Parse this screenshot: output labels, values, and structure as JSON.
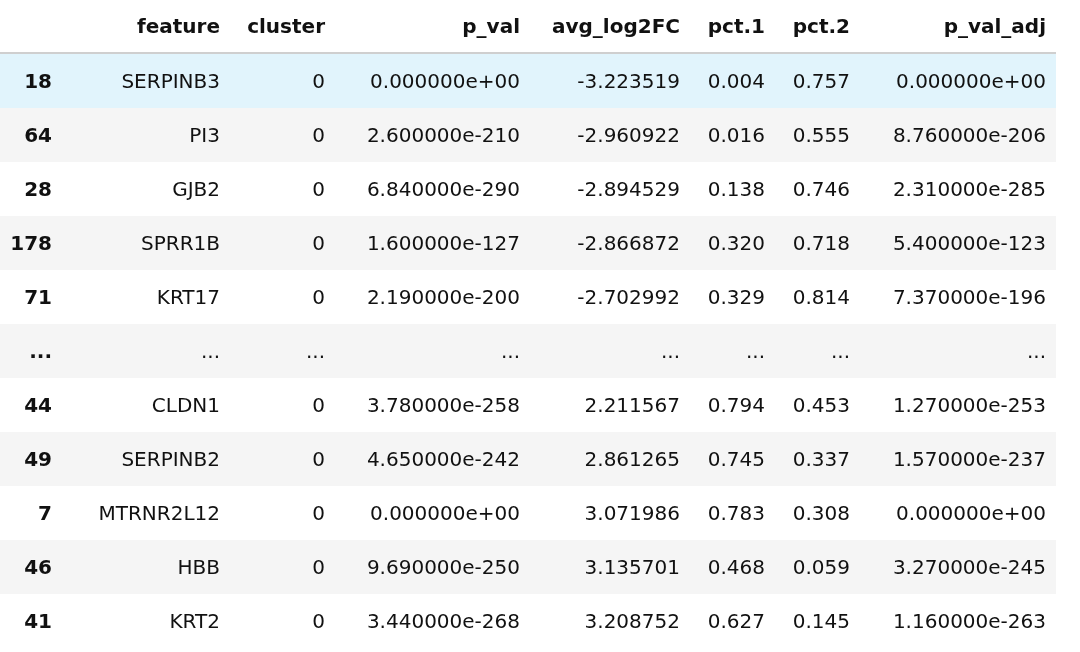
{
  "table": {
    "columns": [
      "",
      "feature",
      "cluster",
      "p_val",
      "avg_log2FC",
      "pct.1",
      "pct.2",
      "p_val_adj"
    ],
    "rows": [
      {
        "cells": [
          "18",
          "SERPINB3",
          "0",
          "0.000000e+00",
          "-3.223519",
          "0.004",
          "0.757",
          "0.000000e+00"
        ],
        "selected": true
      },
      {
        "cells": [
          "64",
          "PI3",
          "0",
          "2.600000e-210",
          "-2.960922",
          "0.016",
          "0.555",
          "8.760000e-206"
        ],
        "selected": false
      },
      {
        "cells": [
          "28",
          "GJB2",
          "0",
          "6.840000e-290",
          "-2.894529",
          "0.138",
          "0.746",
          "2.310000e-285"
        ],
        "selected": false
      },
      {
        "cells": [
          "178",
          "SPRR1B",
          "0",
          "1.600000e-127",
          "-2.866872",
          "0.320",
          "0.718",
          "5.400000e-123"
        ],
        "selected": false
      },
      {
        "cells": [
          "71",
          "KRT17",
          "0",
          "2.190000e-200",
          "-2.702992",
          "0.329",
          "0.814",
          "7.370000e-196"
        ],
        "selected": false
      },
      {
        "cells": [
          "...",
          "...",
          "...",
          "...",
          "...",
          "...",
          "...",
          "..."
        ],
        "selected": false
      },
      {
        "cells": [
          "44",
          "CLDN1",
          "0",
          "3.780000e-258",
          "2.211567",
          "0.794",
          "0.453",
          "1.270000e-253"
        ],
        "selected": false
      },
      {
        "cells": [
          "49",
          "SERPINB2",
          "0",
          "4.650000e-242",
          "2.861265",
          "0.745",
          "0.337",
          "1.570000e-237"
        ],
        "selected": false
      },
      {
        "cells": [
          "7",
          "MTRNR2L12",
          "0",
          "0.000000e+00",
          "3.071986",
          "0.783",
          "0.308",
          "0.000000e+00"
        ],
        "selected": false
      },
      {
        "cells": [
          "46",
          "HBB",
          "0",
          "9.690000e-250",
          "3.135701",
          "0.468",
          "0.059",
          "3.270000e-245"
        ],
        "selected": false
      },
      {
        "cells": [
          "41",
          "KRT2",
          "0",
          "3.440000e-268",
          "3.208752",
          "0.627",
          "0.145",
          "1.160000e-263"
        ],
        "selected": false
      }
    ]
  }
}
